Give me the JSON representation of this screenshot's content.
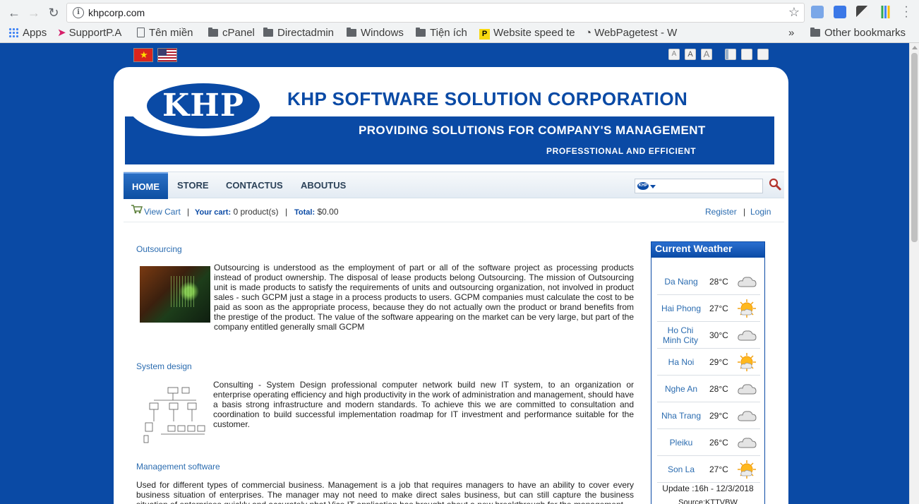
{
  "browser": {
    "url": "khpcorp.com",
    "bookmarks": {
      "apps": "Apps",
      "supportpa": "SupportP.A",
      "ten_mien": "Tên miền",
      "cpanel": "cPanel",
      "directadmin": "Directadmin",
      "windows": "Windows",
      "tien_ich": "Tiện ích",
      "website_speed": "Website speed te",
      "webpagetest": "WebPagetest - W",
      "overflow": "»",
      "other": "Other bookmarks"
    }
  },
  "header": {
    "logo_text": "KHP",
    "company_name": "KHP SOFTWARE SOLUTION CORPORATION",
    "slogan_main": "PROVIDING SOLUTIONS FOR COMPANY'S MANAGEMENT",
    "slogan_sub": "PROFESSTIONAL AND EFFICIENT",
    "font_tools": [
      "A",
      "A",
      "A"
    ]
  },
  "menu": {
    "items": [
      "HOME",
      "STORE",
      "CONTACTUS",
      "ABOUTUS"
    ],
    "active": "HOME",
    "search_badge": "KHP"
  },
  "cart": {
    "view_cart": "View Cart",
    "your_cart_label": "Your cart:",
    "your_cart_value": "0 product(s)",
    "total_label": "Total:",
    "total_value": "$0.00",
    "register": "Register",
    "login": "Login",
    "sep": "|"
  },
  "articles": [
    {
      "title": "Outsourcing",
      "text": "Outsourcing is understood as the employment of part or all of the software project as processing products instead of product ownership. The disposal of lease products belong Outsourcing. The mission of Outsourcing unit is made products to satisfy the requirements of units and outsourcing organization, not involved in product sales - such GCPM just a stage in a process products to users. GCPM companies must calculate the cost to be paid as soon as the appropriate process, because they do not actually own the product or brand benefits from the prestige of the product. The value of the software appearing on the market can be very large, but part of the company entitled generally small GCPM"
    },
    {
      "title": "System design",
      "text": "Consulting - System Design professional computer network build new IT system, to an organization or enterprise operating efficiency and high productivity in the work of administration and management, should have a basis strong infrastructure and modern standards. To achieve this we are committed to consultation and coordination to build successful implementation roadmap for IT investment and performance suitable for the customer."
    },
    {
      "title": "Management software",
      "text": "Used for different types of commercial business. Management is a job that requires managers to have an ability to cover every business situation of enterprises. The manager may not need to make direct sales business, but can still capture the business situation of enterprises quickly and accurately nhat Vico IT application has brought about a new breakthrough for the management."
    }
  ],
  "weather": {
    "title": "Current Weather",
    "rows": [
      {
        "city": "Da Nang",
        "temp": "28°C",
        "icon": "cloud-icon"
      },
      {
        "city": "Hai Phong",
        "temp": "27°C",
        "icon": "sun-icon"
      },
      {
        "city": "Ho Chi Minh City",
        "temp": "30°C",
        "icon": "cloud-icon"
      },
      {
        "city": "Ha Noi",
        "temp": "29°C",
        "icon": "sun-icon"
      },
      {
        "city": "Nghe An",
        "temp": "28°C",
        "icon": "cloud-icon"
      },
      {
        "city": "Nha Trang",
        "temp": "29°C",
        "icon": "cloud-icon"
      },
      {
        "city": "Pleiku",
        "temp": "26°C",
        "icon": "cloud-icon"
      },
      {
        "city": "Son La",
        "temp": "27°C",
        "icon": "sun-icon"
      }
    ],
    "update": "Update :16h - 12/3/2018",
    "source": "Source:KTTVBW"
  },
  "colors": {
    "brand_blue": "#0a4aa5",
    "link_blue": "#2b6cb0"
  }
}
